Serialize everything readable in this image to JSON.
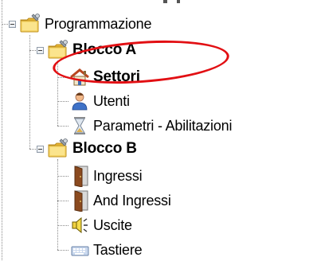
{
  "tree": {
    "root": {
      "label": "Programmazione",
      "icon": "folder-wrench-icon",
      "expanded": true
    },
    "groups": [
      {
        "label": "Blocco A",
        "icon": "folder-wrench-icon",
        "expanded": true,
        "children": [
          {
            "label": "Settori",
            "icon": "home-icon",
            "bold": true
          },
          {
            "label": "Utenti",
            "icon": "user-icon"
          },
          {
            "label": "Parametri - Abilitazioni",
            "icon": "hourglass-icon"
          }
        ]
      },
      {
        "label": "Blocco B",
        "icon": "folder-wrench-icon",
        "expanded": true,
        "children": [
          {
            "label": "Ingressi",
            "icon": "door-icon"
          },
          {
            "label": "And Ingressi",
            "icon": "door-icon"
          },
          {
            "label": "Uscite",
            "icon": "speaker-icon"
          },
          {
            "label": "Tastiere",
            "icon": "keyboard-icon"
          }
        ]
      }
    ]
  },
  "colors": {
    "highlight": "#e20f13",
    "folder": "#f2c445",
    "connector": "#8a8a8a"
  }
}
